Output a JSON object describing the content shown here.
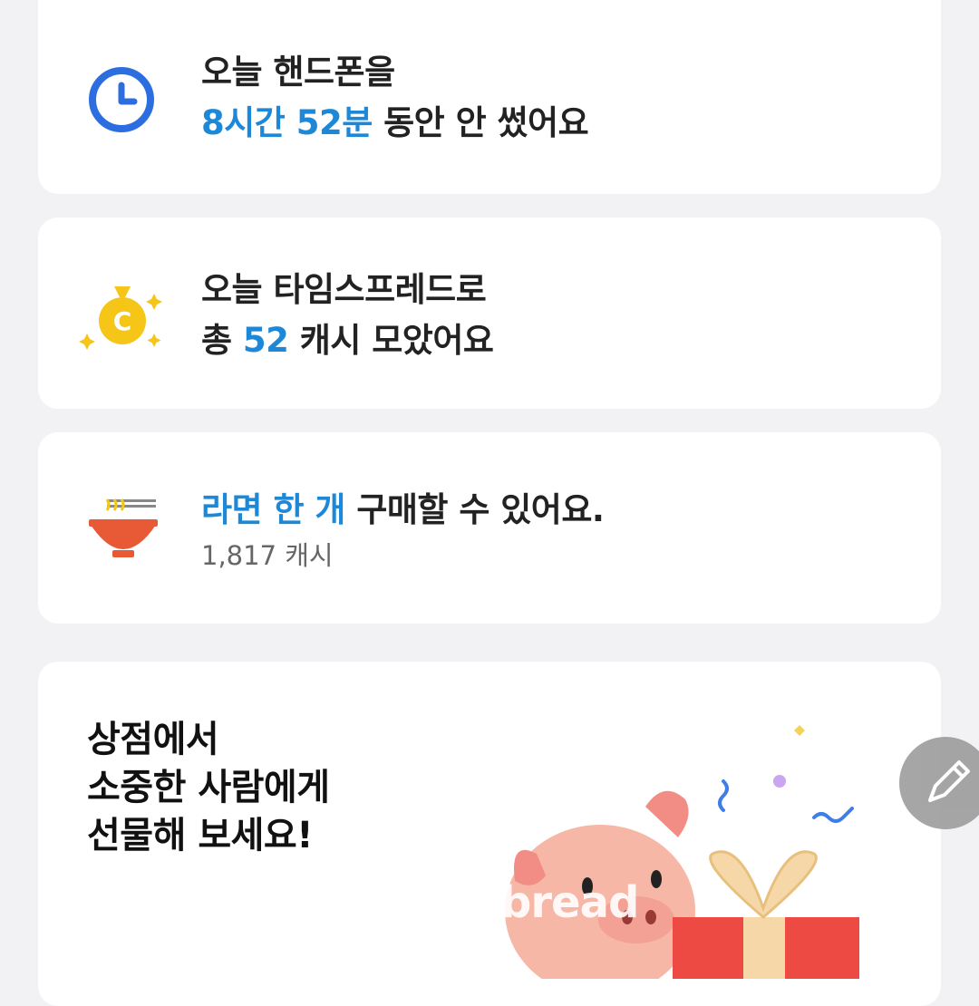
{
  "time_card": {
    "line1": "오늘 핸드폰을",
    "duration": "8시간 52분",
    "line2_rest": " 동안 안 썼어요",
    "icon": "clock-icon"
  },
  "cash_card": {
    "line1": "오늘 타임스프레드로",
    "prefix": "총 ",
    "amount": "52",
    "suffix": " 캐시 모았어요",
    "icon": "money-bag-icon"
  },
  "ramen_card": {
    "highlight": "라면 한 개",
    "rest": " 구매할 수 있어요.",
    "price": "1,817 캐시",
    "icon": "ramen-bowl-icon"
  },
  "shop_card": {
    "line1": "상점에서",
    "line2": "소중한 사람에게",
    "line3": "선물해 보세요!",
    "illustration": "pig-with-gift"
  },
  "watermark": "bread",
  "colors": {
    "accent": "#1e88d8",
    "background": "#f2f2f4",
    "card": "#ffffff",
    "ramen_bowl": "#e85a35",
    "coin": "#f5c518"
  }
}
